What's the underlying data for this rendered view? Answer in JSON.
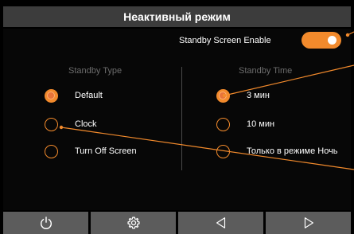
{
  "header": {
    "title": "Неактивный режим"
  },
  "standby_enable": {
    "label": "Standby Screen Enable",
    "enabled": true
  },
  "standby_type": {
    "title": "Standby Type",
    "options": [
      {
        "label": "Default",
        "selected": true
      },
      {
        "label": "Clock",
        "selected": false
      },
      {
        "label": "Turn Off Screen",
        "selected": false
      }
    ]
  },
  "standby_time": {
    "title": "Standby Time",
    "options": [
      {
        "label": "3 мин",
        "selected": true
      },
      {
        "label": "10 мин",
        "selected": false
      },
      {
        "label": "Только в режиме Ночь",
        "selected": false
      }
    ]
  },
  "toolbar": {
    "buttons": [
      {
        "icon": "power-icon"
      },
      {
        "icon": "gear-icon"
      },
      {
        "icon": "back-triangle-icon"
      },
      {
        "icon": "forward-triangle-icon"
      }
    ]
  },
  "colors": {
    "accent": "#f28a2c",
    "title_bar": "#3c3c3c",
    "button": "#5c5c5c",
    "background": "#000000"
  }
}
